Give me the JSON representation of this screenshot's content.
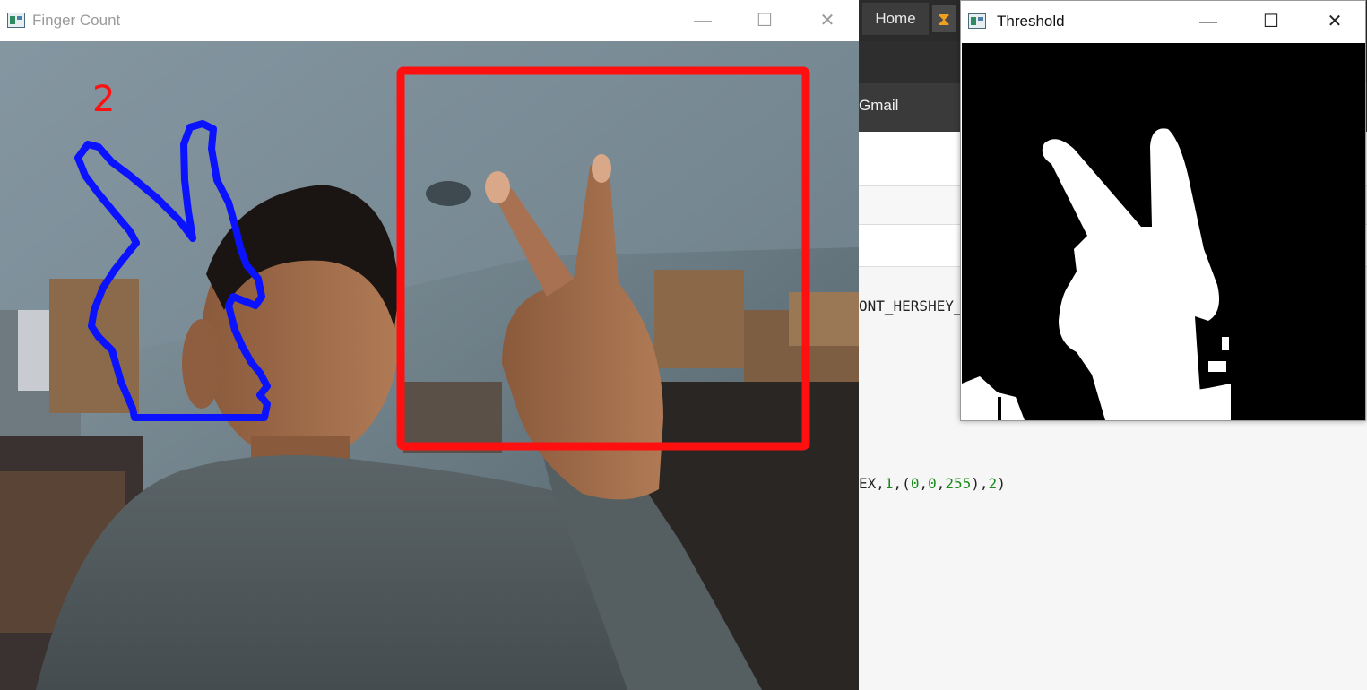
{
  "background_app": {
    "home_label": "Home",
    "hourglass_icon": "hourglass-icon",
    "bookmark_label": "Gmail",
    "code_line_1": "ONT_HERSHEY_",
    "code_line_2_prefix": "EX,",
    "code_line_2_args": [
      "1",
      "0",
      "0",
      "255",
      "2"
    ]
  },
  "finger_window": {
    "title": "Finger Count",
    "finger_count": "2",
    "colors": {
      "roi_box": "#ff0000",
      "contour": "#0000ff",
      "count_text": "#ff0000"
    }
  },
  "threshold_window": {
    "title": "Threshold"
  },
  "window_controls": {
    "minimize_icon": "minimize-icon",
    "maximize_icon": "maximize-icon",
    "close_icon": "close-icon",
    "minimize_glyph": "—",
    "maximize_glyph": "☐",
    "close_glyph": "✕"
  }
}
